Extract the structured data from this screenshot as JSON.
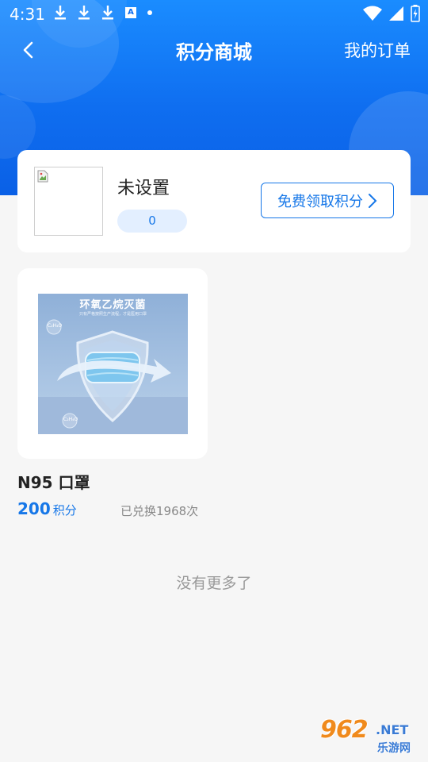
{
  "status_bar": {
    "time": "4:31",
    "left_icons": [
      "download-icon",
      "download-icon",
      "download-icon",
      "text-a-icon",
      "dot-icon"
    ],
    "right_icons": [
      "wifi-icon",
      "signal-icon",
      "battery-icon"
    ]
  },
  "nav": {
    "back_icon": "chevron-left-icon",
    "title": "积分商城",
    "right_link": "我的订单"
  },
  "user_card": {
    "avatar_icon": "broken-image-icon",
    "name": "未设置",
    "points": "0",
    "free_button_label": "免费领取积分",
    "free_button_icon": "chevron-right-icon"
  },
  "products": [
    {
      "image_title": "环氧乙烷灭菌",
      "image_subtitle": "只有严格按照生产流程，才是医用口罩",
      "image_badges": [
        "C₂H₄O",
        "C₂H₄O"
      ],
      "name": "N95 口罩",
      "price": "200",
      "price_unit": "积分",
      "redeemed": "已兑换1968次"
    }
  ],
  "footer_text": "没有更多了",
  "watermark": {
    "number": "962",
    "net": ".NET",
    "cn": "乐游网"
  },
  "colors": {
    "header_blue": "#0f6ef0",
    "accent_blue": "#1677e8",
    "pill_bg": "#e3efff",
    "page_bg": "#f6f6f6"
  }
}
